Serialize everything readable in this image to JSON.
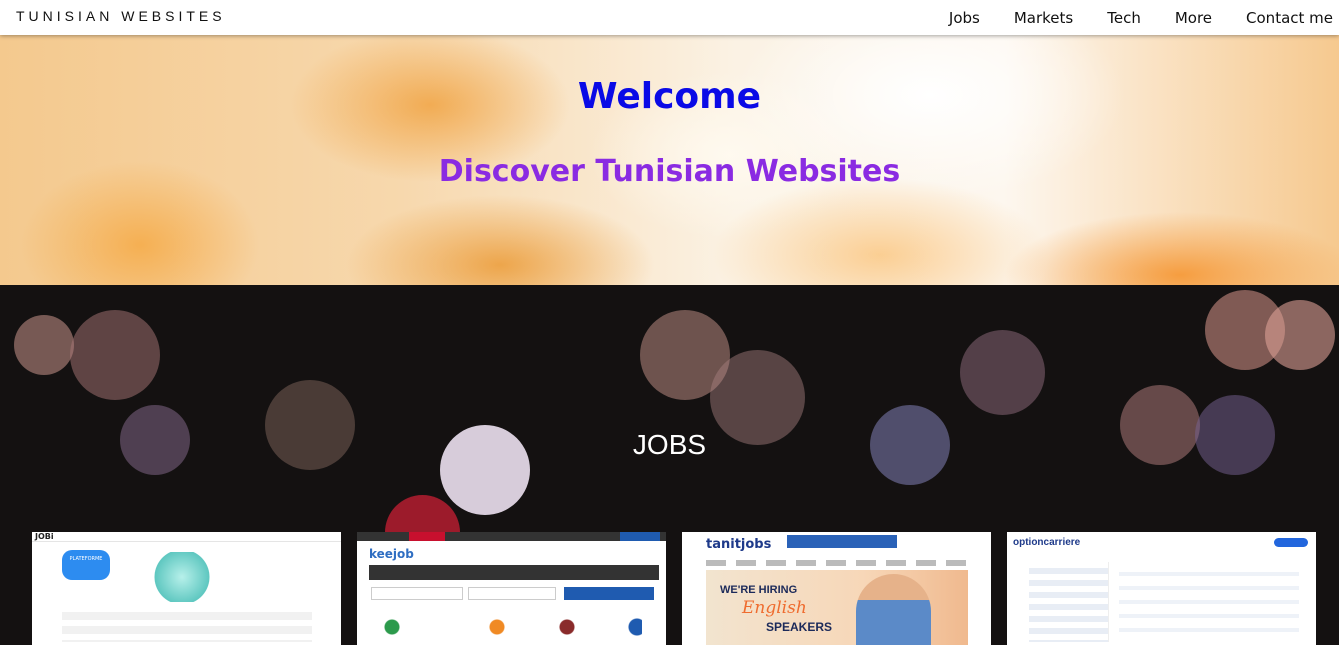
{
  "nav": {
    "brand": "TUNISIAN WEBSITES",
    "links": [
      "Jobs",
      "Markets",
      "Tech",
      "More",
      "Contact me"
    ]
  },
  "hero": {
    "title": "Welcome",
    "subtitle": "Discover Tunisian Websites",
    "title_color": "#0a0ae6",
    "subtitle_color": "#8a2be2"
  },
  "jobs_section": {
    "title": "JOBS",
    "cards": [
      {
        "name": "jobi-screenshot",
        "label": "PLATEFORME"
      },
      {
        "name": "keejob-screenshot",
        "label": "keejob"
      },
      {
        "name": "tanitjobs-screenshot",
        "label": "tanitjobs",
        "ad_line1": "WE'RE HIRING",
        "ad_line2": "English",
        "ad_line3": "SPEAKERS"
      },
      {
        "name": "optioncarriere-screenshot",
        "label": "optioncarriere"
      }
    ]
  }
}
